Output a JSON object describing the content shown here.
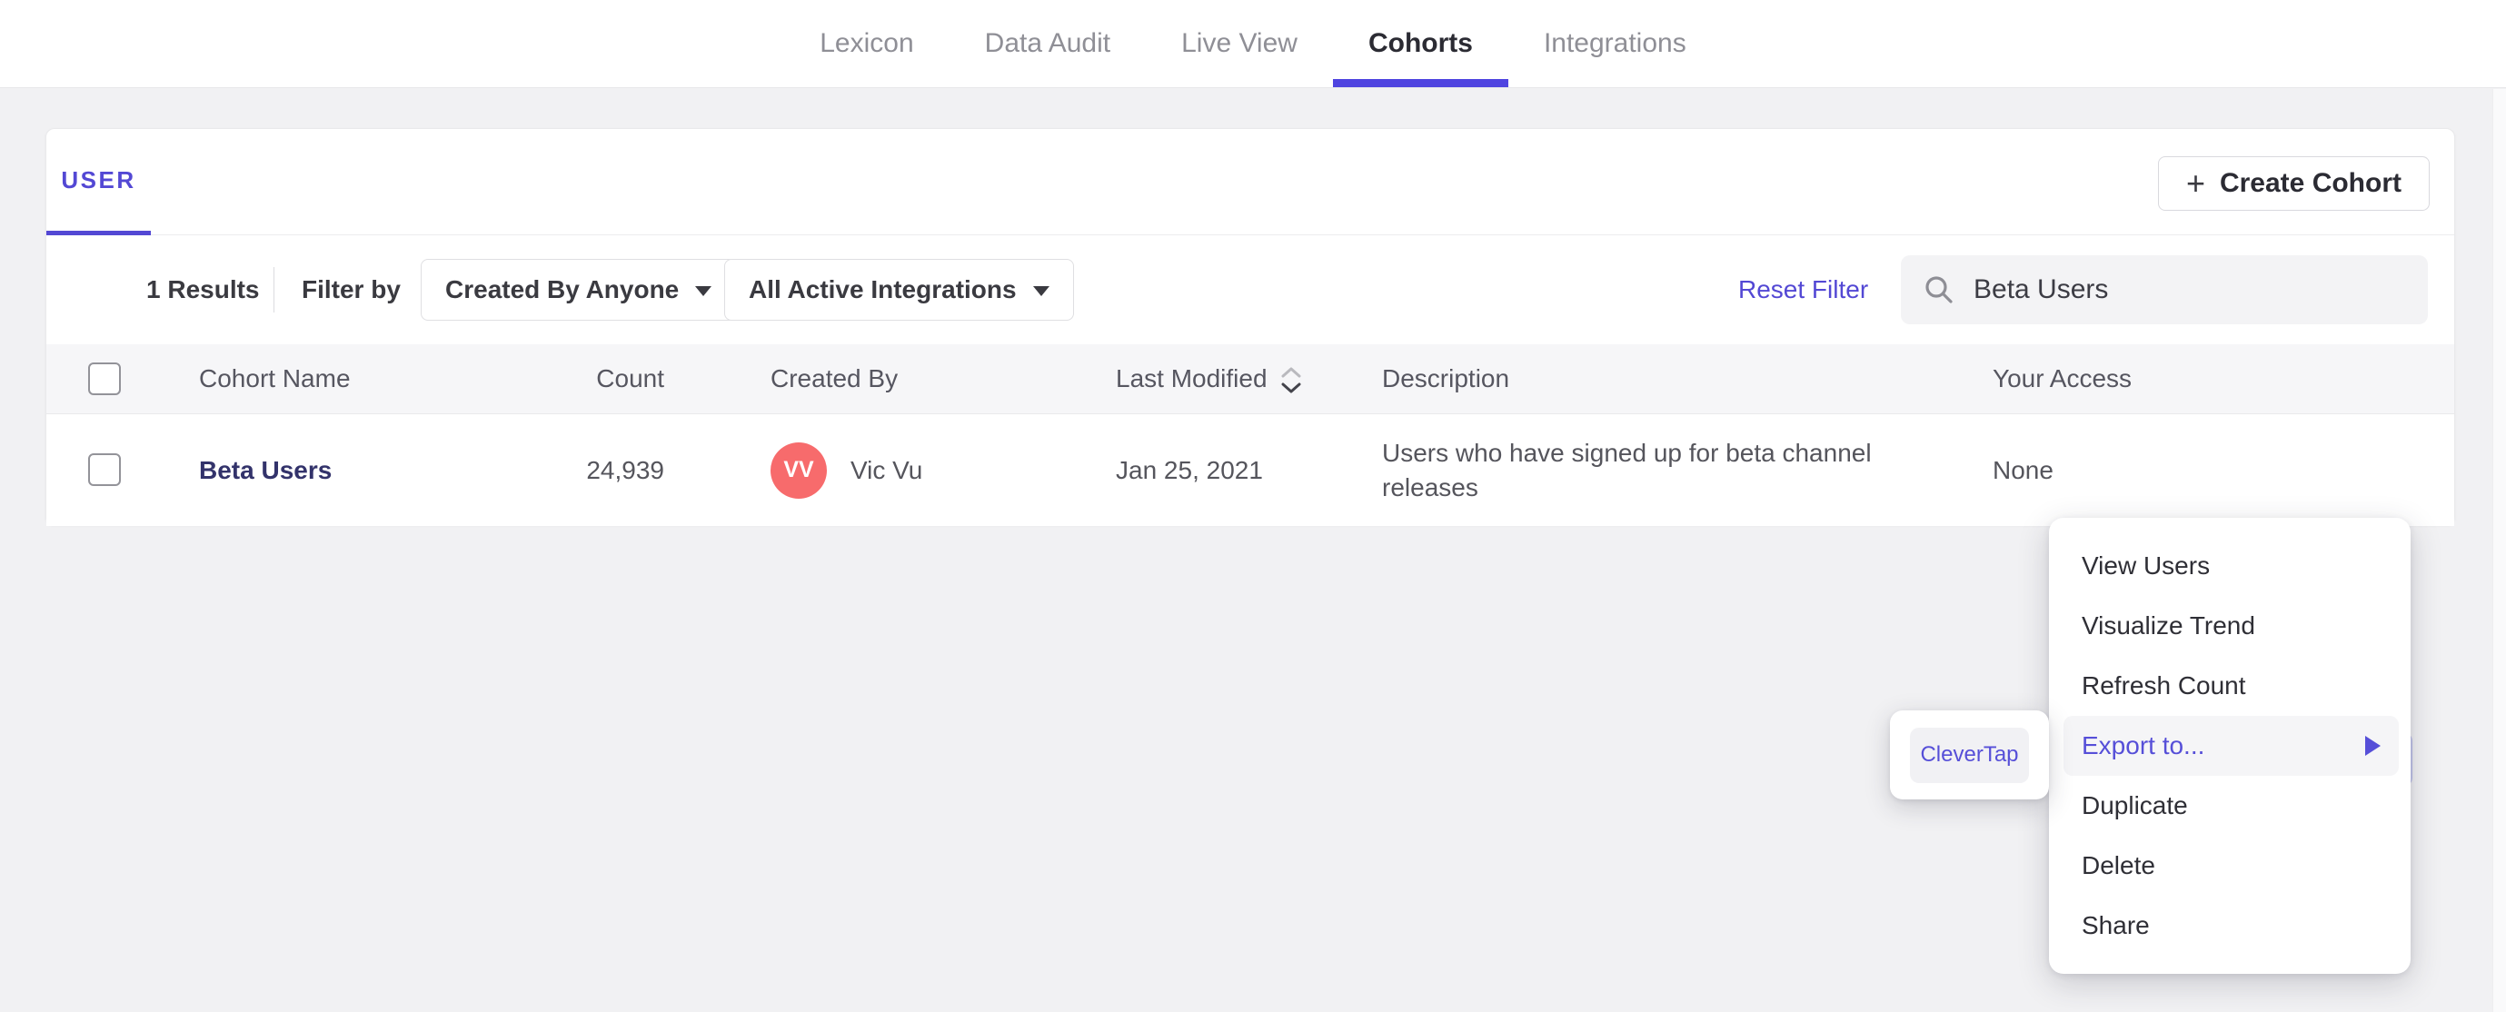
{
  "nav": {
    "items": [
      {
        "label": "Lexicon",
        "active": false
      },
      {
        "label": "Data Audit",
        "active": false
      },
      {
        "label": "Live View",
        "active": false
      },
      {
        "label": "Cohorts",
        "active": true
      },
      {
        "label": "Integrations",
        "active": false
      }
    ]
  },
  "cohorts_page": {
    "tabs": [
      {
        "label": "USER",
        "active": true
      }
    ],
    "create_button": {
      "label": "Create Cohort"
    },
    "filters": {
      "results_count": "1 Results",
      "filter_by_label": "Filter by",
      "created_by_dropdown": "Created By Anyone",
      "integrations_dropdown": "All Active Integrations",
      "reset_label": "Reset Filter",
      "search": {
        "value": "Beta Users"
      }
    },
    "table": {
      "columns": [
        "Cohort Name",
        "Count",
        "Created By",
        "Last Modified",
        "Description",
        "Your Access"
      ],
      "rows": [
        {
          "name": "Beta Users",
          "count": "24,939",
          "creator_initials": "VV",
          "creator": "Vic Vu",
          "last_modified": "Jan 25, 2021",
          "description": "Users who have signed up for beta channel releases",
          "access": "None"
        }
      ]
    }
  },
  "context_menu": {
    "items": [
      "View Users",
      "Visualize Trend",
      "Refresh Count",
      "Export to...",
      "Duplicate",
      "Delete",
      "Share"
    ],
    "highlighted_item": "Export to..."
  },
  "export_submenu": {
    "items": [
      "CleverTap"
    ]
  },
  "icons": {
    "plus": "+"
  },
  "colors": {
    "accent": "#5348d4",
    "nav_underline": "#4f44e0",
    "cohort_link": "#33336b",
    "avatar_bg": "#f76b6c",
    "page_bg": "#f1f1f3",
    "table_header_bg": "#f6f6f8",
    "menu_highlight_bg": "#f5f5f7",
    "more_button_bg": "#ced0f1"
  }
}
